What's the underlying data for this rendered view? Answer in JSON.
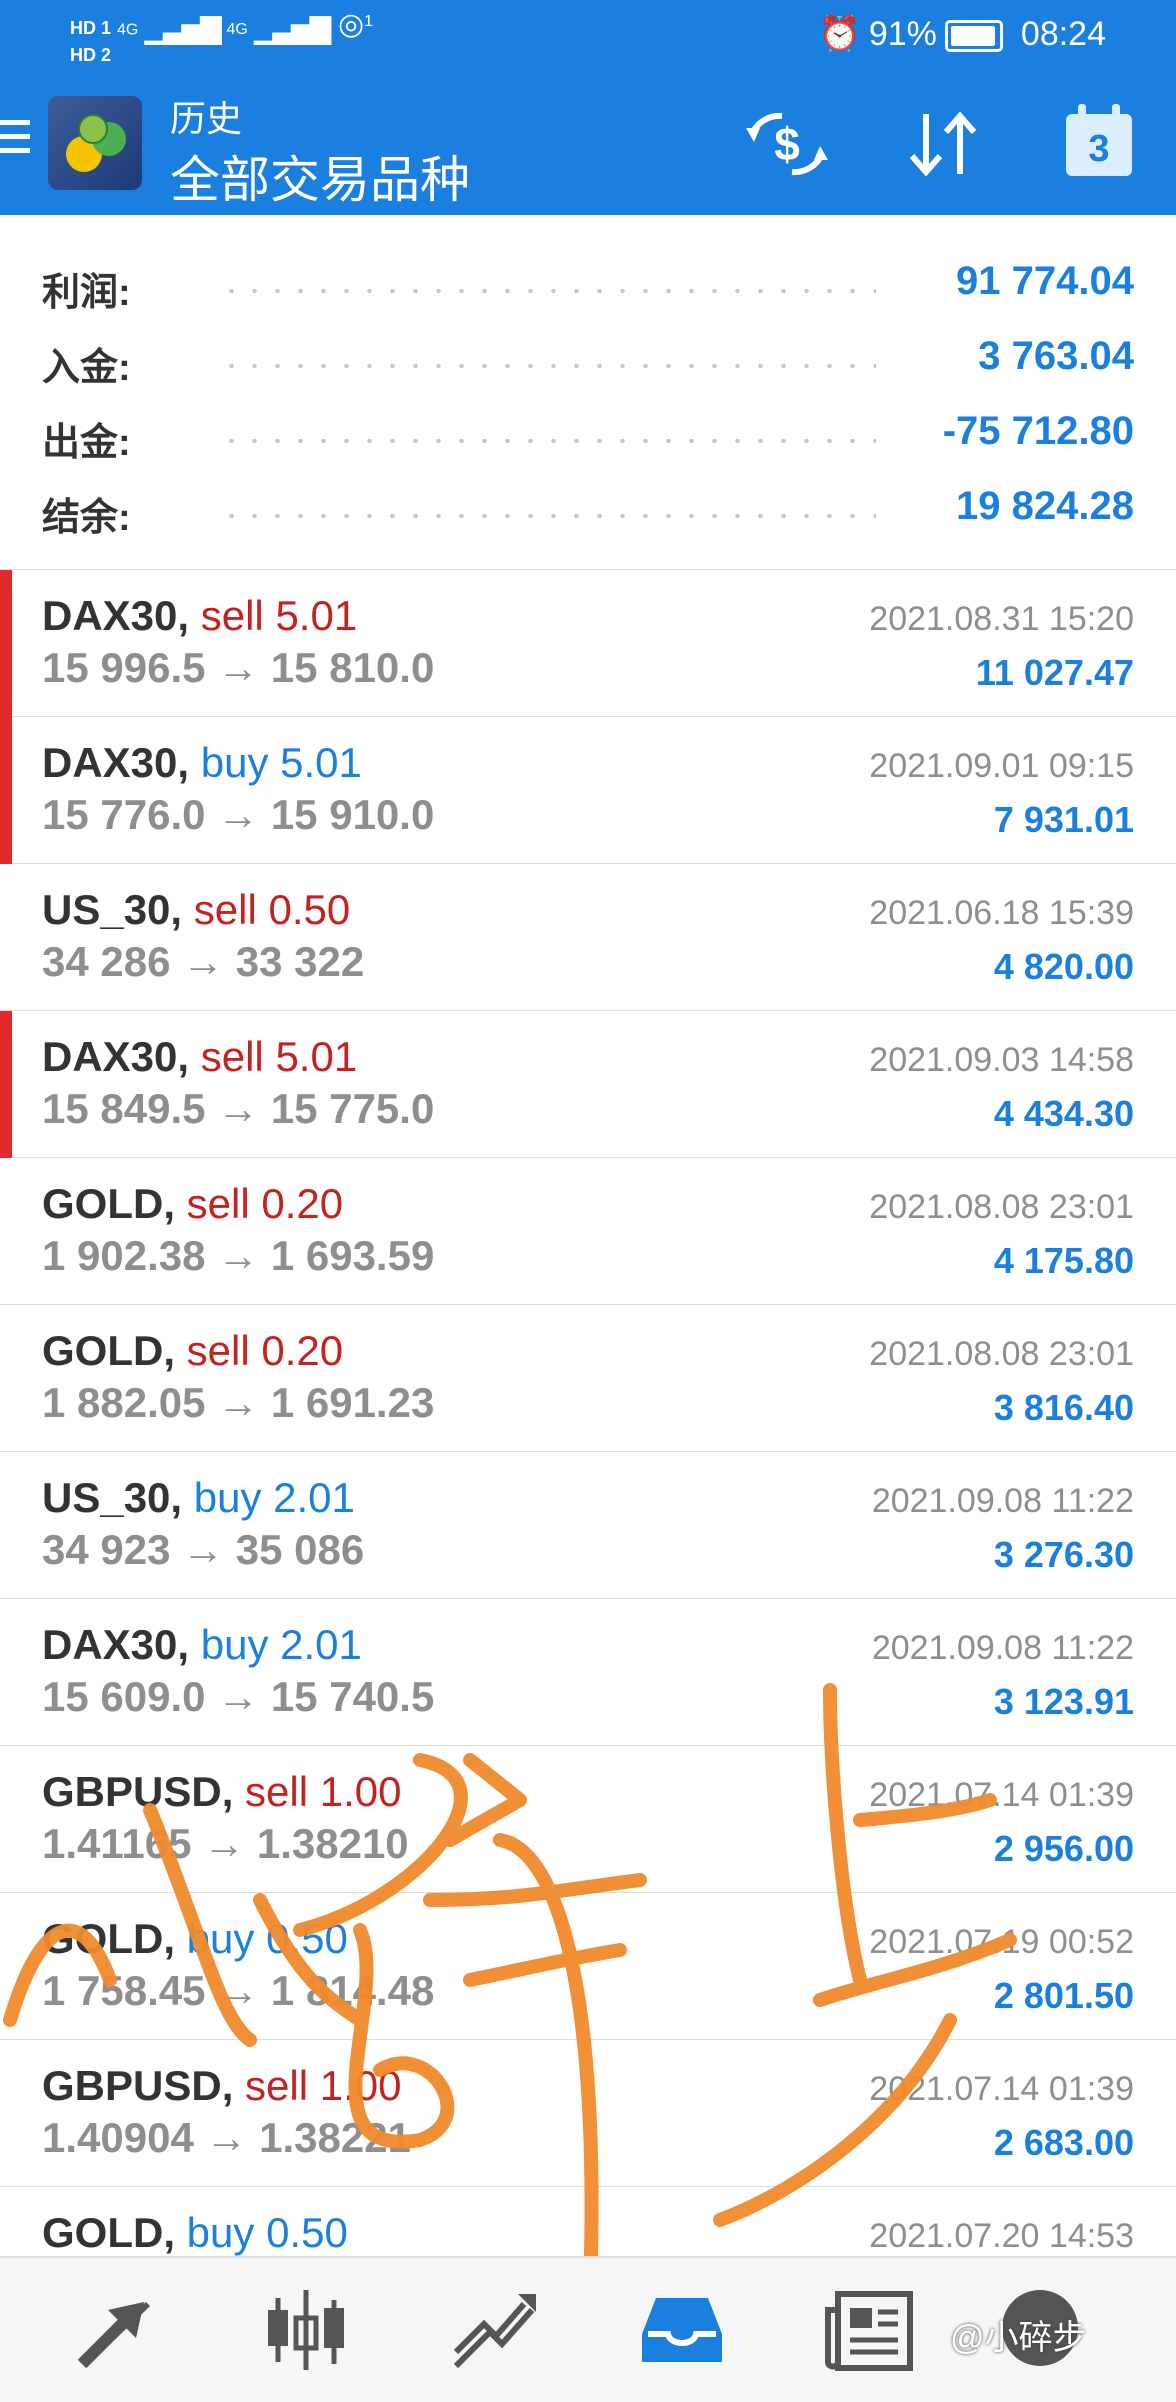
{
  "status_bar": {
    "hd1": "HD 1",
    "hd2": "HD 2",
    "net1": "4G",
    "net2": "4G",
    "hotspot": "1",
    "battery": "91%",
    "time": "08:24"
  },
  "header": {
    "subtitle": "历史",
    "title": "全部交易品种",
    "calendar_day": "3"
  },
  "summary": [
    {
      "label": "利润:",
      "value": "91 774.04"
    },
    {
      "label": "入金:",
      "value": "3 763.04"
    },
    {
      "label": "出金:",
      "value": "-75 712.80"
    },
    {
      "label": "结余:",
      "value": "19 824.28"
    }
  ],
  "deals": [
    {
      "symbol": "DAX30,",
      "side": "sell",
      "volume": "5.01",
      "prices": "15 996.5 → 15 810.0",
      "time": "2021.08.31 15:20",
      "profit": "11 027.47",
      "marked": true
    },
    {
      "symbol": "DAX30,",
      "side": "buy",
      "volume": "5.01",
      "prices": "15 776.0 → 15 910.0",
      "time": "2021.09.01 09:15",
      "profit": "7 931.01",
      "marked": true
    },
    {
      "symbol": "US_30,",
      "side": "sell",
      "volume": "0.50",
      "prices": "34 286 → 33 322",
      "time": "2021.06.18 15:39",
      "profit": "4 820.00",
      "marked": false
    },
    {
      "symbol": "DAX30,",
      "side": "sell",
      "volume": "5.01",
      "prices": "15 849.5 → 15 775.0",
      "time": "2021.09.03 14:58",
      "profit": "4 434.30",
      "marked": true
    },
    {
      "symbol": "GOLD,",
      "side": "sell",
      "volume": "0.20",
      "prices": "1 902.38 → 1 693.59",
      "time": "2021.08.08 23:01",
      "profit": "4 175.80",
      "marked": false
    },
    {
      "symbol": "GOLD,",
      "side": "sell",
      "volume": "0.20",
      "prices": "1 882.05 → 1 691.23",
      "time": "2021.08.08 23:01",
      "profit": "3 816.40",
      "marked": false
    },
    {
      "symbol": "US_30,",
      "side": "buy",
      "volume": "2.01",
      "prices": "34 923 → 35 086",
      "time": "2021.09.08 11:22",
      "profit": "3 276.30",
      "marked": false
    },
    {
      "symbol": "DAX30,",
      "side": "buy",
      "volume": "2.01",
      "prices": "15 609.0 → 15 740.5",
      "time": "2021.09.08 11:22",
      "profit": "3 123.91",
      "marked": false
    },
    {
      "symbol": "GBPUSD,",
      "side": "sell",
      "volume": "1.00",
      "prices": "1.41165 → 1.38210",
      "time": "2021.07.14 01:39",
      "profit": "2 956.00",
      "marked": false
    },
    {
      "symbol": "GOLD,",
      "side": "buy",
      "volume": "0.50",
      "prices": "1 758.45 → 1 814.48",
      "time": "2021.07.19 00:52",
      "profit": "2 801.50",
      "marked": false
    },
    {
      "symbol": "GBPUSD,",
      "side": "sell",
      "volume": "1.00",
      "prices": "1.40904 → 1.38221",
      "time": "2021.07.14 01:39",
      "profit": "2 683.00",
      "marked": false
    },
    {
      "symbol": "GOLD,",
      "side": "buy",
      "volume": "0.50",
      "prices": "",
      "time": "2021.07.20 14:53",
      "profit": "",
      "marked": false
    }
  ],
  "bottom_nav": [
    {
      "icon": "quotes-arrows-icon"
    },
    {
      "icon": "candlestick-chart-icon"
    },
    {
      "icon": "trade-line-icon"
    },
    {
      "icon": "history-inbox-icon",
      "active": true
    },
    {
      "icon": "news-icon"
    },
    {
      "icon": "chat-icon"
    }
  ],
  "watermark": {
    "handle": "@小碎步"
  },
  "colors": {
    "accent": "#1a7fdf",
    "sell": "#c42121",
    "marker": "#e02b2b",
    "watermark": "#f08a2c"
  }
}
